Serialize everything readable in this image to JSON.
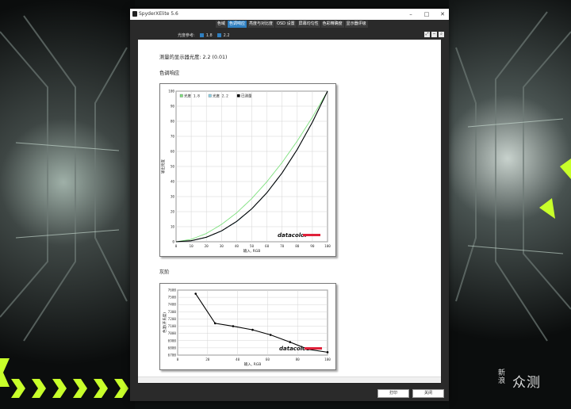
{
  "window": {
    "title": "SpyderXElite 5.6",
    "min": "–",
    "max": "□",
    "close": "✕"
  },
  "tabs": [
    "色域",
    "色调响应",
    "亮度与对比度",
    "OSD 设置",
    "屏幕均匀性",
    "色彩精确度",
    "显示器评级"
  ],
  "active_tab": 1,
  "reference": {
    "label": "光度参考:",
    "opt1": "1.8",
    "opt2": "2.2"
  },
  "report": {
    "measured": "测量的显示器光度:  2.2 (0.01)",
    "tone_heading": "色调响应",
    "gray_heading": "灰阶"
  },
  "buttons": {
    "print": "打印",
    "close": "关闭"
  },
  "watermark": {
    "cn": "新浪",
    "brand": "众测"
  },
  "colors": {
    "accent": "#2f7fc0",
    "g18": "#7ee07e",
    "g22": "#8fd3e8",
    "measured": "#000000",
    "logo_bar": "#e0223a"
  },
  "chart_data": [
    {
      "type": "line",
      "title": "",
      "xlabel": "输入, RGB",
      "ylabel": "输出亮度",
      "xlim": [
        0,
        100
      ],
      "ylim": [
        0,
        100
      ],
      "x_ticks": [
        0,
        10,
        20,
        30,
        40,
        50,
        60,
        70,
        80,
        90,
        100
      ],
      "y_ticks": [
        0,
        10,
        20,
        30,
        40,
        50,
        60,
        70,
        80,
        90,
        100
      ],
      "grid": true,
      "legend": "top-left",
      "logo": "datacolor",
      "series": [
        {
          "name": "光度 1.8",
          "color": "#7ee07e",
          "x": [
            0,
            10,
            20,
            30,
            40,
            50,
            60,
            70,
            80,
            90,
            100
          ],
          "y": [
            0,
            1.6,
            5.5,
            11.5,
            19.2,
            28.7,
            39.9,
            52.6,
            66.9,
            82.7,
            100
          ]
        },
        {
          "name": "光度 2.2",
          "color": "#8fd3e8",
          "x": [
            0,
            10,
            20,
            30,
            40,
            50,
            60,
            70,
            80,
            90,
            100
          ],
          "y": [
            0,
            0.6,
            2.9,
            7.1,
            13.3,
            21.8,
            32.5,
            45.6,
            61.2,
            79.3,
            100
          ]
        },
        {
          "name": "已测量",
          "color": "#000000",
          "x": [
            0,
            10,
            20,
            30,
            40,
            50,
            60,
            70,
            80,
            90,
            100
          ],
          "y": [
            0,
            0.7,
            3.0,
            7.2,
            13.5,
            21.9,
            32.6,
            45.7,
            61.3,
            79.4,
            100
          ]
        }
      ]
    },
    {
      "type": "line",
      "title": "",
      "xlabel": "输入, RGB",
      "ylabel": "色温(开氏度)",
      "xlim": [
        0,
        100
      ],
      "ylim": [
        6700,
        7600
      ],
      "x_ticks": [
        0,
        20,
        40,
        60,
        80,
        100
      ],
      "y_ticks": [
        6700,
        6800,
        6900,
        7000,
        7100,
        7200,
        7300,
        7400,
        7500,
        7600
      ],
      "grid": true,
      "logo": "datacolor",
      "series": [
        {
          "name": "",
          "color": "#000000",
          "x": [
            12,
            25,
            37,
            50,
            62,
            75,
            87,
            100
          ],
          "y": [
            7550,
            7140,
            7100,
            7050,
            6980,
            6880,
            6780,
            6740
          ]
        }
      ]
    }
  ]
}
